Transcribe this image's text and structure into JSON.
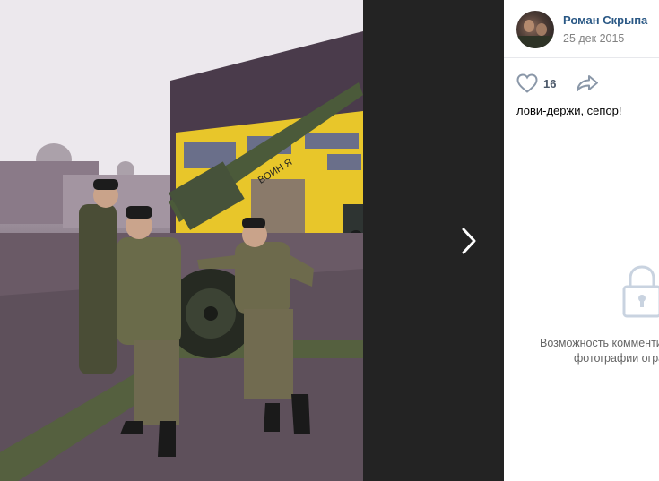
{
  "author": {
    "name": "Роман Скрыпа",
    "date": "25 дек 2015"
  },
  "actions": {
    "like_count": "16",
    "like_icon": "heart-outline-icon",
    "share_icon": "share-arrow-icon"
  },
  "post": {
    "caption": "лови-держи, сепор!"
  },
  "comments": {
    "notice_line1": "Возможность комменти",
    "notice_line2": "фотографии огра",
    "icon": "padlock-icon"
  },
  "photo": {
    "barrel_marking": "ВОИН Я"
  },
  "viewer": {
    "next_icon": "chevron-right-icon"
  },
  "colors": {
    "link": "#2a5885",
    "muted": "#828282",
    "building_yellow": "#e8c62a",
    "building_dark": "#4a3b4b"
  }
}
